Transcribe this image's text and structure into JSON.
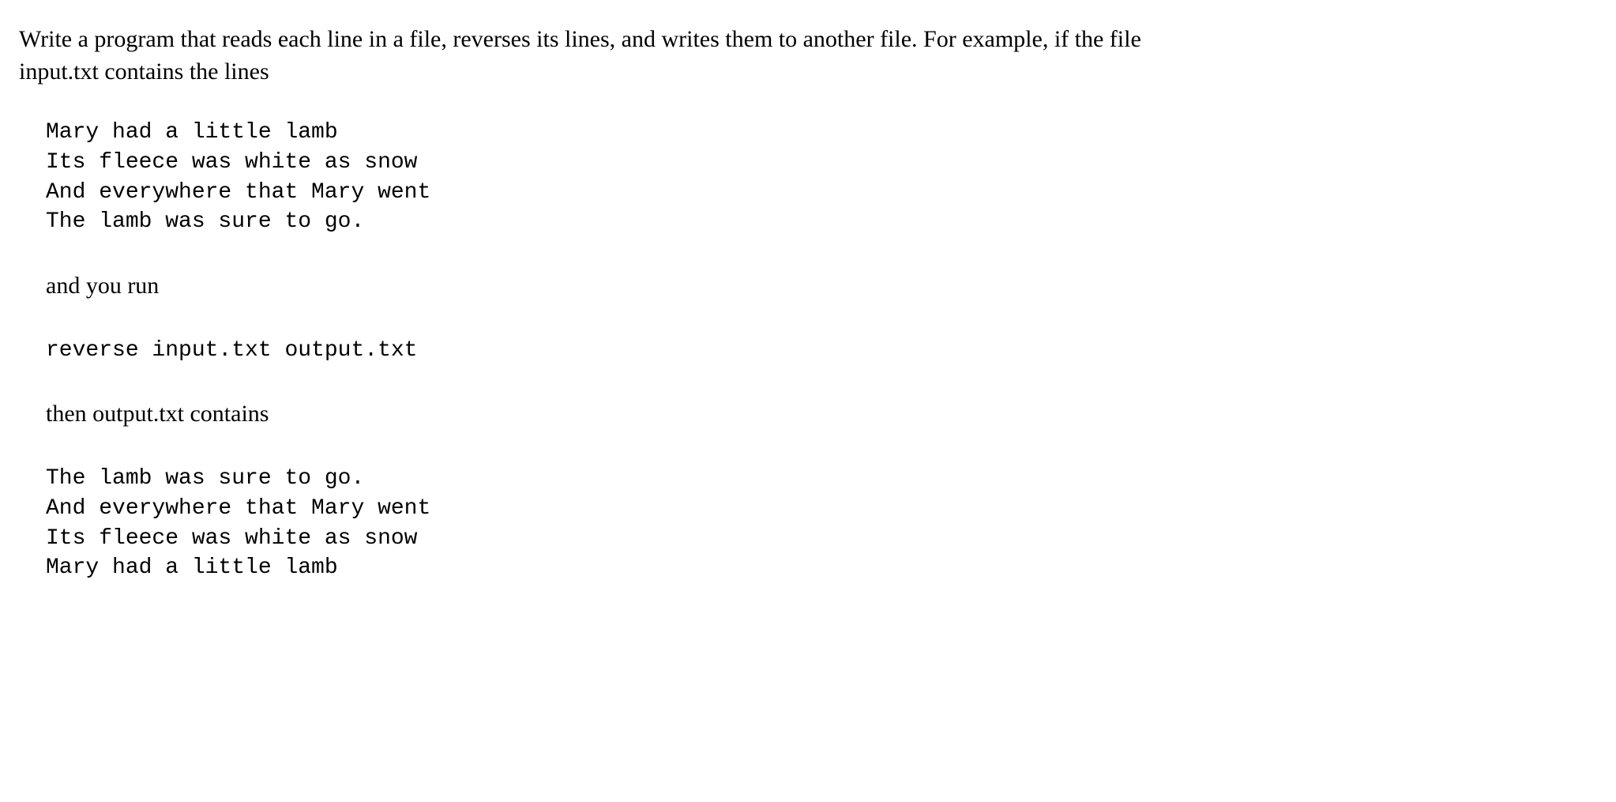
{
  "intro": "Write a program that reads each line in a file, reverses its lines, and writes them to another file. For example, if the file input.txt contains the lines",
  "input_lines": "Mary had a little lamb\nIts fleece was white as snow\nAnd everywhere that Mary went\nThe lamb was sure to go.",
  "run_label": "and you run",
  "command": "reverse input.txt output.txt",
  "output_label": "then output.txt contains",
  "output_lines": "The lamb was sure to go.\nAnd everywhere that Mary went\nIts fleece was white as snow\nMary had a little lamb"
}
